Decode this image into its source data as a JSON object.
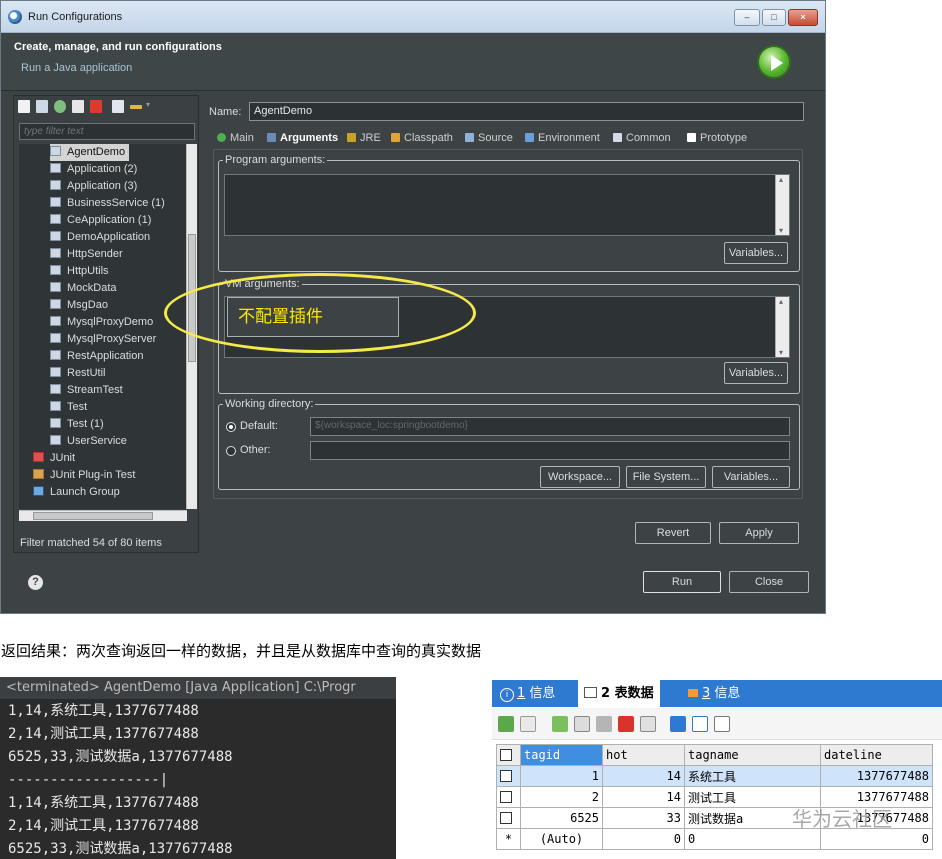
{
  "window": {
    "title": "Run Configurations",
    "header_title": "Create, manage, and run configurations",
    "header_subtitle": "Run a Java application",
    "controls": {
      "minimize": "–",
      "maximize": "□",
      "close": "×"
    }
  },
  "left_panel": {
    "filter_placeholder": "type filter text",
    "items": [
      {
        "label": "AgentDemo",
        "selected": true
      },
      {
        "label": "Application (2)"
      },
      {
        "label": "Application (3)"
      },
      {
        "label": "BusinessService (1)"
      },
      {
        "label": "CeApplication (1)"
      },
      {
        "label": "DemoApplication"
      },
      {
        "label": "HttpSender"
      },
      {
        "label": "HttpUtils"
      },
      {
        "label": "MockData"
      },
      {
        "label": "MsgDao"
      },
      {
        "label": "MysqlProxyDemo"
      },
      {
        "label": "MysqlProxyServer"
      },
      {
        "label": "RestApplication"
      },
      {
        "label": "RestUtil"
      },
      {
        "label": "StreamTest"
      },
      {
        "label": "Test"
      },
      {
        "label": "Test (1)"
      },
      {
        "label": "UserService"
      }
    ],
    "groups": [
      "JUnit",
      "JUnit Plug-in Test",
      "Launch Group"
    ],
    "status": "Filter matched 54 of 80 items"
  },
  "config": {
    "name_label": "Name:",
    "name_value": "AgentDemo",
    "tabs": [
      {
        "label": "Main",
        "color": "#4caf50"
      },
      {
        "label": "Arguments",
        "color": "#6a8bb5",
        "active": true
      },
      {
        "label": "JRE",
        "color": "#c9a227"
      },
      {
        "label": "Classpath",
        "color": "#e0a23a"
      },
      {
        "label": "Source",
        "color": "#8fb1d8"
      },
      {
        "label": "Environment",
        "color": "#6aa0d8"
      },
      {
        "label": "Common",
        "color": "#d6d9e6"
      },
      {
        "label": "Prototype",
        "color": "#ffffff"
      }
    ],
    "program_args_label": "Program arguments:",
    "vm_args_label": "VM arguments:",
    "vm_callout": "不配置插件",
    "variables_label": "Variables...",
    "working_dir_label": "Working directory:",
    "default_label": "Default:",
    "default_value": "${workspace_loc:springbootdemo}",
    "other_label": "Other:",
    "workspace_btn": "Workspace...",
    "filesystem_btn": "File System...",
    "revert_btn": "Revert",
    "apply_btn": "Apply",
    "run_btn": "Run",
    "close_btn": "Close",
    "help": "?"
  },
  "caption": "返回结果：两次查询返回一样的数据，并且是从数据库中查询的真实数据",
  "console": {
    "header": "<terminated> AgentDemo [Java Application] C:\\Progr",
    "lines": [
      "1,14,系统工具,1377677488",
      "2,14,测试工具,1377677488",
      "6525,33,测试数据a,1377677488",
      "------------------|",
      "1,14,系统工具,1377677488",
      "2,14,测试工具,1377677488",
      "6525,33,测试数据a,1377677488"
    ]
  },
  "result_panel": {
    "tabs": [
      {
        "num": "1",
        "label": "信息"
      },
      {
        "num": "2",
        "label": "表数据",
        "active": true
      },
      {
        "num": "3",
        "label": "信息"
      }
    ],
    "columns": [
      "tagid",
      "hot",
      "tagname",
      "dateline"
    ],
    "rows": [
      {
        "marker": "",
        "tagid": "1",
        "hot": "14",
        "tagname": "系统工具",
        "dateline": "1377677488"
      },
      {
        "marker": "",
        "tagid": "2",
        "hot": "14",
        "tagname": "测试工具",
        "dateline": "1377677488"
      },
      {
        "marker": "",
        "tagid": "6525",
        "hot": "33",
        "tagname": "测试数据a",
        "dateline": "1377677488"
      },
      {
        "marker": "*",
        "tagid": "(Auto)",
        "hot": "0",
        "tagname": "0",
        "dateline": "0"
      }
    ],
    "watermark": "华为云社区"
  }
}
